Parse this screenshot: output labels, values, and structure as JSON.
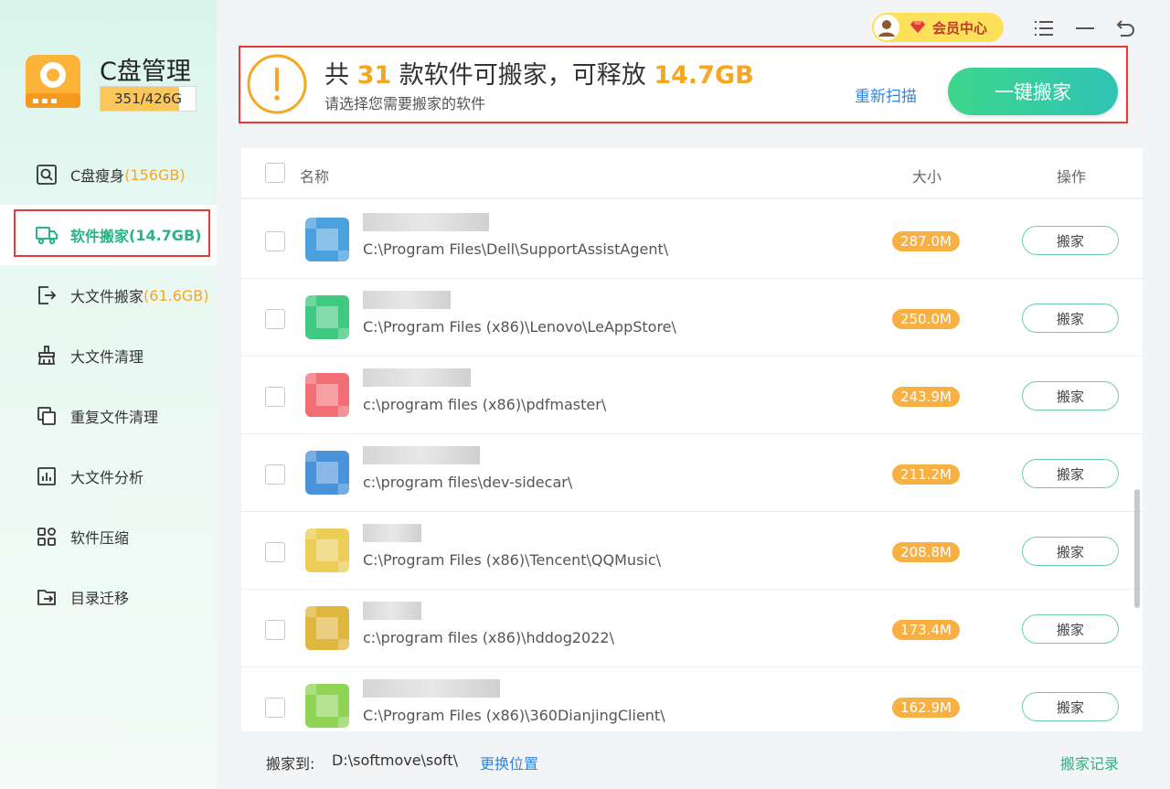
{
  "app": {
    "title": "C盘管理",
    "usage_text": "351/426G",
    "usage_fraction": 0.824
  },
  "sidebar": {
    "items": [
      {
        "label": "C盘瘦身",
        "size": "(156GB)",
        "icon": "disk-search-icon"
      },
      {
        "label": "软件搬家",
        "size": "(14.7GB)",
        "icon": "truck-icon",
        "active": true
      },
      {
        "label": "大文件搬家",
        "size": "(61.6GB)",
        "icon": "file-export-icon"
      },
      {
        "label": "大文件清理",
        "size": "",
        "icon": "broom-icon"
      },
      {
        "label": "重复文件清理",
        "size": "",
        "icon": "duplicate-icon"
      },
      {
        "label": "大文件分析",
        "size": "",
        "icon": "bar-chart-icon"
      },
      {
        "label": "软件压缩",
        "size": "",
        "icon": "grid-icon"
      },
      {
        "label": "目录迁移",
        "size": "",
        "icon": "folder-move-icon"
      }
    ]
  },
  "topbar": {
    "vip_label": "会员中心",
    "icons": [
      "menu-icon",
      "minimize-icon",
      "back-icon"
    ]
  },
  "banner": {
    "prefix": "共",
    "count": "31",
    "middle": "款软件可搬家，可释放",
    "size": "14.7GB",
    "subtitle": "请选择您需要搬家的软件",
    "rescan_label": "重新扫描",
    "onekey_label": "一键搬家"
  },
  "table": {
    "headers": {
      "name": "名称",
      "size": "大小",
      "action": "操作"
    },
    "rows": [
      {
        "path": "C:\\Program Files\\Dell\\SupportAssistAgent\\",
        "size": "287.0M",
        "action": "搬家",
        "icon_color": "#2b8fd8"
      },
      {
        "path": "C:\\Program Files (x86)\\Lenovo\\LeAppStore\\",
        "size": "250.0M",
        "action": "搬家",
        "icon_color": "#1fbf6b"
      },
      {
        "path": "c:\\program files (x86)\\pdfmaster\\",
        "size": "243.9M",
        "action": "搬家",
        "icon_color": "#f0555d"
      },
      {
        "path": "c:\\program files\\dev-sidecar\\",
        "size": "211.2M",
        "action": "搬家",
        "icon_color": "#2a7fd4"
      },
      {
        "path": "C:\\Program Files (x86)\\Tencent\\QQMusic\\",
        "size": "208.8M",
        "action": "搬家",
        "icon_color": "#e8c43a"
      },
      {
        "path": "c:\\program files (x86)\\hddog2022\\",
        "size": "173.4M",
        "action": "搬家",
        "icon_color": "#d9a91c"
      },
      {
        "path": "C:\\Program Files (x86)\\360DianjingClient\\",
        "size": "162.9M",
        "action": "搬家",
        "icon_color": "#7ccc3a"
      }
    ]
  },
  "footer": {
    "label": "搬家到:",
    "path": "D:\\softmove\\soft\\",
    "change_label": "更换位置",
    "history_label": "搬家记录"
  }
}
